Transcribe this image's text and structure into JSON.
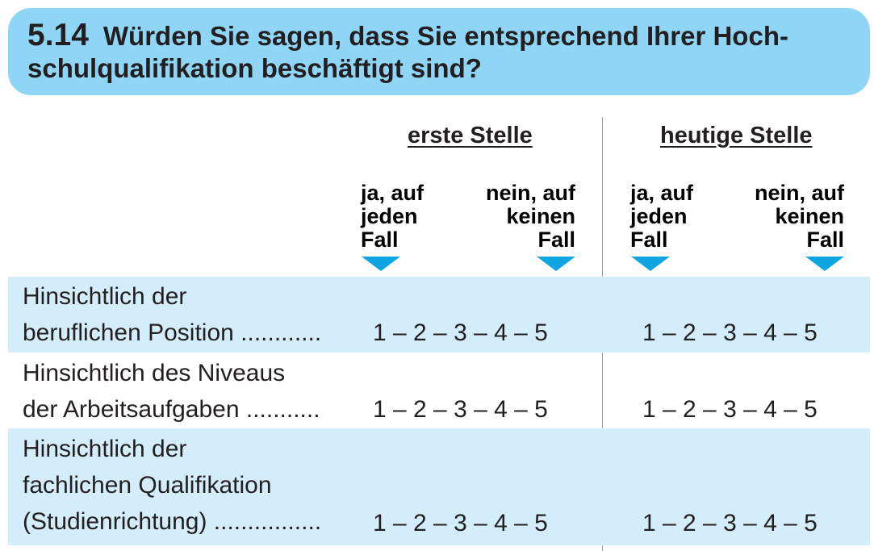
{
  "question": {
    "number": "5.14",
    "text": "Würden Sie sagen, dass Sie entsprechend Ihrer Hoch-\nschulqualifikation beschäftigt sind?"
  },
  "columns": [
    {
      "title": "erste Stelle",
      "left_label": "ja, auf\njeden\nFall",
      "right_label": "nein, auf\nkeinen\nFall"
    },
    {
      "title": "heutige Stelle",
      "left_label": "ja, auf\njeden\nFall",
      "right_label": "nein, auf\nkeinen\nFall"
    }
  ],
  "rows": [
    {
      "label": "Hinsichtlich der\nberuflichen Position ............",
      "scale_first": "1 – 2 – 3 – 4 – 5",
      "scale_current": "1 – 2 – 3 – 4 – 5",
      "shaded": true
    },
    {
      "label": "Hinsichtlich des Niveaus\nder Arbeitsaufgaben  ...........",
      "scale_first": "1 – 2 – 3 – 4 – 5",
      "scale_current": "1 – 2 – 3 – 4 – 5",
      "shaded": false
    },
    {
      "label": "Hinsichtlich der\nfachlichen Qualifikation\n(Studienrichtung) ................",
      "scale_first": "1 – 2 – 3 – 4 – 5",
      "scale_current": "1 – 2 – 3 – 4 – 5",
      "shaded": true
    }
  ],
  "colors": {
    "header_bg": "#8fd6f6",
    "row_shade": "#d4edfa",
    "arrow": "#0ea5e2"
  }
}
